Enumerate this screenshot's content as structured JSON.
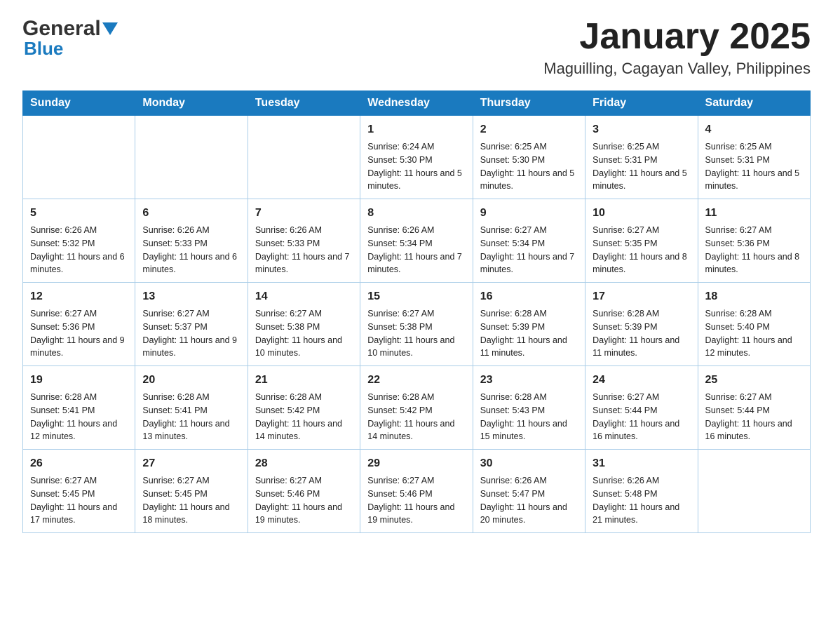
{
  "header": {
    "logo_general": "General",
    "logo_blue": "Blue",
    "month_title": "January 2025",
    "location": "Maguilling, Cagayan Valley, Philippines"
  },
  "days_of_week": [
    "Sunday",
    "Monday",
    "Tuesday",
    "Wednesday",
    "Thursday",
    "Friday",
    "Saturday"
  ],
  "weeks": [
    [
      {
        "day": "",
        "info": ""
      },
      {
        "day": "",
        "info": ""
      },
      {
        "day": "",
        "info": ""
      },
      {
        "day": "1",
        "info": "Sunrise: 6:24 AM\nSunset: 5:30 PM\nDaylight: 11 hours and 5 minutes."
      },
      {
        "day": "2",
        "info": "Sunrise: 6:25 AM\nSunset: 5:30 PM\nDaylight: 11 hours and 5 minutes."
      },
      {
        "day": "3",
        "info": "Sunrise: 6:25 AM\nSunset: 5:31 PM\nDaylight: 11 hours and 5 minutes."
      },
      {
        "day": "4",
        "info": "Sunrise: 6:25 AM\nSunset: 5:31 PM\nDaylight: 11 hours and 5 minutes."
      }
    ],
    [
      {
        "day": "5",
        "info": "Sunrise: 6:26 AM\nSunset: 5:32 PM\nDaylight: 11 hours and 6 minutes."
      },
      {
        "day": "6",
        "info": "Sunrise: 6:26 AM\nSunset: 5:33 PM\nDaylight: 11 hours and 6 minutes."
      },
      {
        "day": "7",
        "info": "Sunrise: 6:26 AM\nSunset: 5:33 PM\nDaylight: 11 hours and 7 minutes."
      },
      {
        "day": "8",
        "info": "Sunrise: 6:26 AM\nSunset: 5:34 PM\nDaylight: 11 hours and 7 minutes."
      },
      {
        "day": "9",
        "info": "Sunrise: 6:27 AM\nSunset: 5:34 PM\nDaylight: 11 hours and 7 minutes."
      },
      {
        "day": "10",
        "info": "Sunrise: 6:27 AM\nSunset: 5:35 PM\nDaylight: 11 hours and 8 minutes."
      },
      {
        "day": "11",
        "info": "Sunrise: 6:27 AM\nSunset: 5:36 PM\nDaylight: 11 hours and 8 minutes."
      }
    ],
    [
      {
        "day": "12",
        "info": "Sunrise: 6:27 AM\nSunset: 5:36 PM\nDaylight: 11 hours and 9 minutes."
      },
      {
        "day": "13",
        "info": "Sunrise: 6:27 AM\nSunset: 5:37 PM\nDaylight: 11 hours and 9 minutes."
      },
      {
        "day": "14",
        "info": "Sunrise: 6:27 AM\nSunset: 5:38 PM\nDaylight: 11 hours and 10 minutes."
      },
      {
        "day": "15",
        "info": "Sunrise: 6:27 AM\nSunset: 5:38 PM\nDaylight: 11 hours and 10 minutes."
      },
      {
        "day": "16",
        "info": "Sunrise: 6:28 AM\nSunset: 5:39 PM\nDaylight: 11 hours and 11 minutes."
      },
      {
        "day": "17",
        "info": "Sunrise: 6:28 AM\nSunset: 5:39 PM\nDaylight: 11 hours and 11 minutes."
      },
      {
        "day": "18",
        "info": "Sunrise: 6:28 AM\nSunset: 5:40 PM\nDaylight: 11 hours and 12 minutes."
      }
    ],
    [
      {
        "day": "19",
        "info": "Sunrise: 6:28 AM\nSunset: 5:41 PM\nDaylight: 11 hours and 12 minutes."
      },
      {
        "day": "20",
        "info": "Sunrise: 6:28 AM\nSunset: 5:41 PM\nDaylight: 11 hours and 13 minutes."
      },
      {
        "day": "21",
        "info": "Sunrise: 6:28 AM\nSunset: 5:42 PM\nDaylight: 11 hours and 14 minutes."
      },
      {
        "day": "22",
        "info": "Sunrise: 6:28 AM\nSunset: 5:42 PM\nDaylight: 11 hours and 14 minutes."
      },
      {
        "day": "23",
        "info": "Sunrise: 6:28 AM\nSunset: 5:43 PM\nDaylight: 11 hours and 15 minutes."
      },
      {
        "day": "24",
        "info": "Sunrise: 6:27 AM\nSunset: 5:44 PM\nDaylight: 11 hours and 16 minutes."
      },
      {
        "day": "25",
        "info": "Sunrise: 6:27 AM\nSunset: 5:44 PM\nDaylight: 11 hours and 16 minutes."
      }
    ],
    [
      {
        "day": "26",
        "info": "Sunrise: 6:27 AM\nSunset: 5:45 PM\nDaylight: 11 hours and 17 minutes."
      },
      {
        "day": "27",
        "info": "Sunrise: 6:27 AM\nSunset: 5:45 PM\nDaylight: 11 hours and 18 minutes."
      },
      {
        "day": "28",
        "info": "Sunrise: 6:27 AM\nSunset: 5:46 PM\nDaylight: 11 hours and 19 minutes."
      },
      {
        "day": "29",
        "info": "Sunrise: 6:27 AM\nSunset: 5:46 PM\nDaylight: 11 hours and 19 minutes."
      },
      {
        "day": "30",
        "info": "Sunrise: 6:26 AM\nSunset: 5:47 PM\nDaylight: 11 hours and 20 minutes."
      },
      {
        "day": "31",
        "info": "Sunrise: 6:26 AM\nSunset: 5:48 PM\nDaylight: 11 hours and 21 minutes."
      },
      {
        "day": "",
        "info": ""
      }
    ]
  ]
}
